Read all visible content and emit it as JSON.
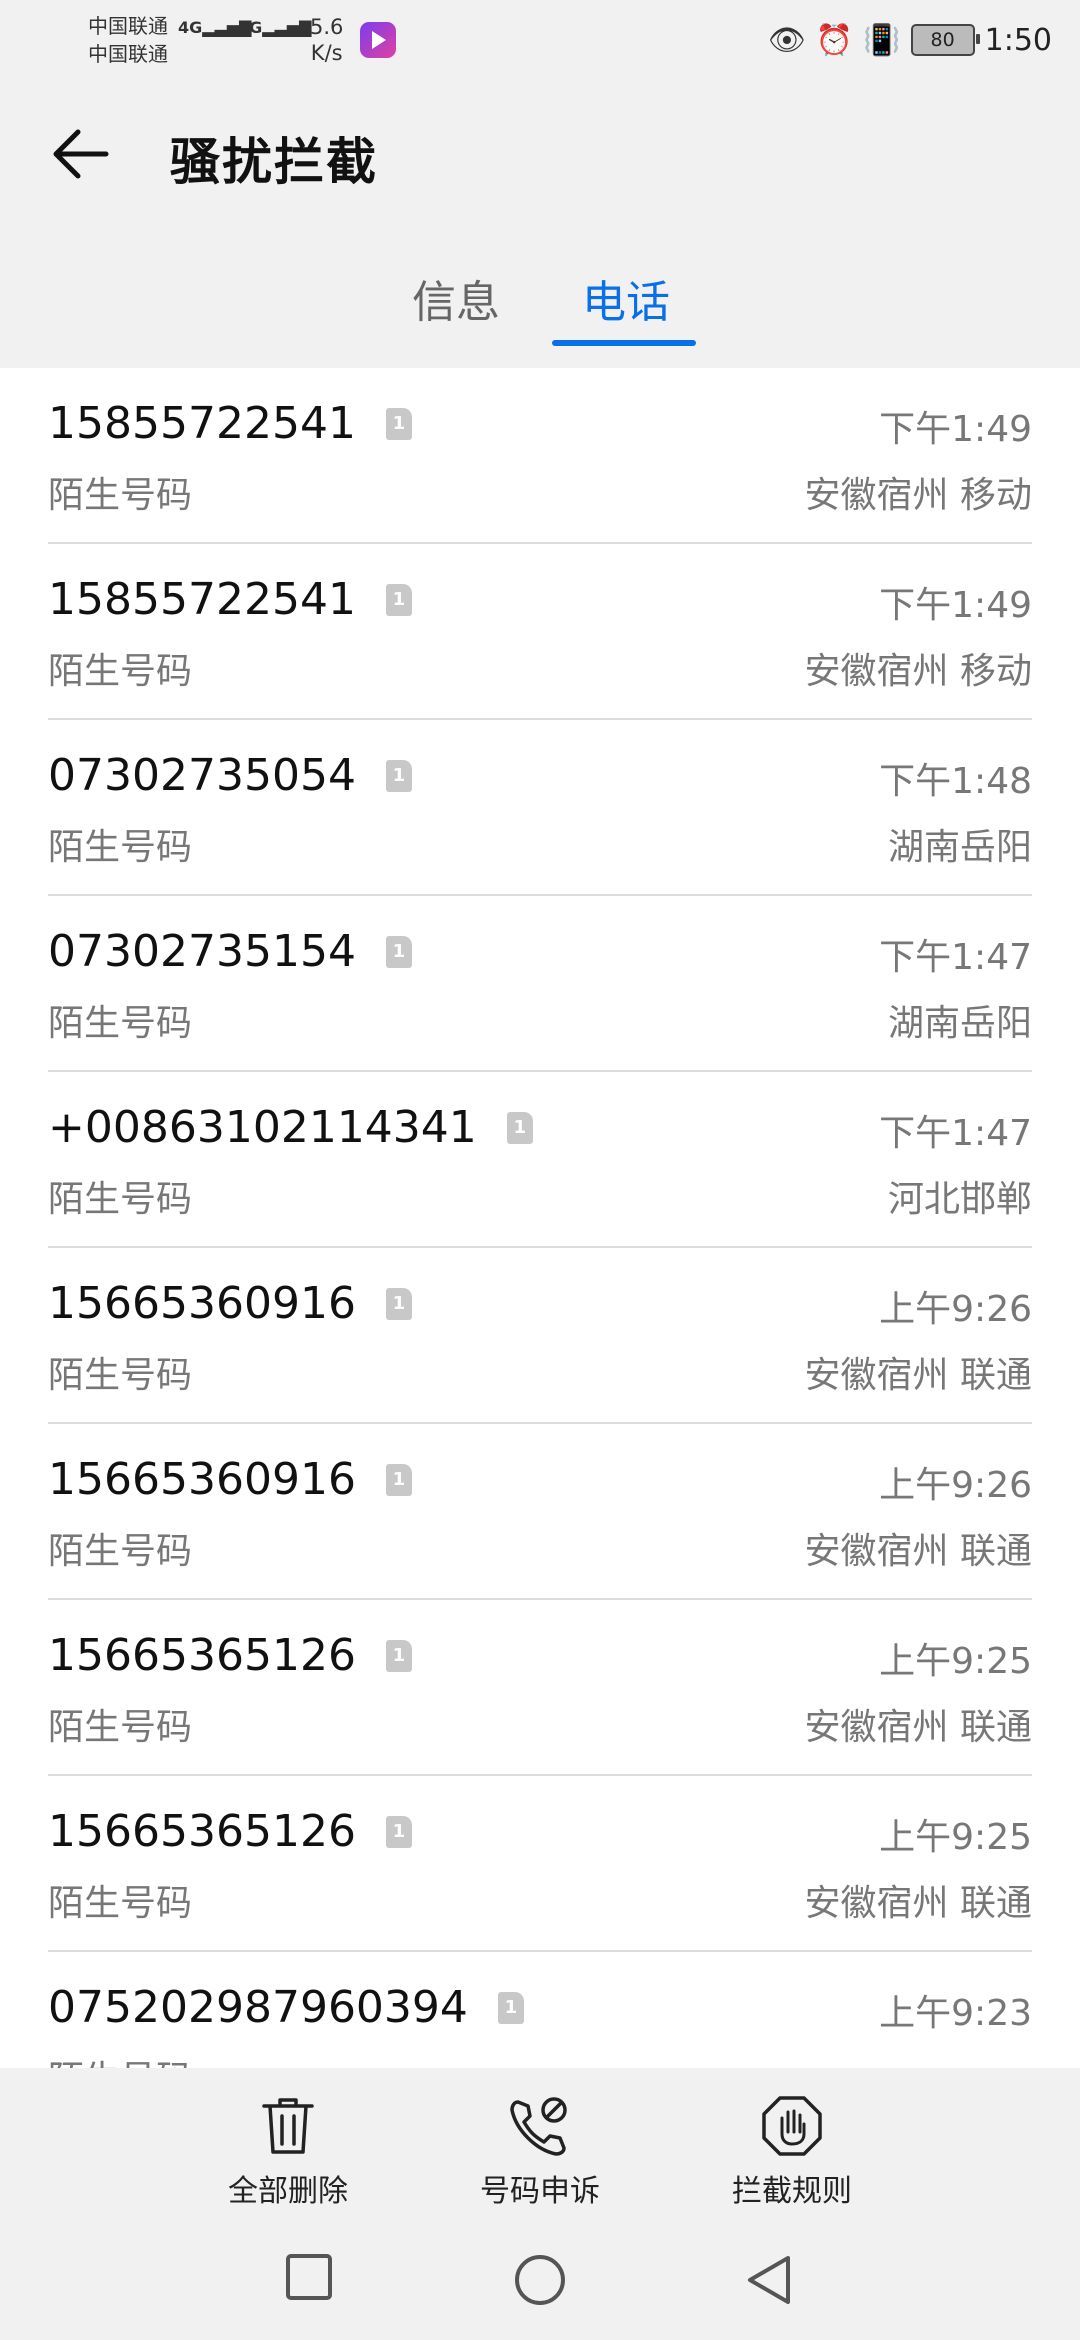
{
  "status_bar": {
    "carrier1": "中国联通",
    "carrier2": "中国联通",
    "net1": "4G",
    "net2": "4G",
    "speed_value": "5.6",
    "speed_unit": "K/s",
    "battery": "80",
    "time": "1:50"
  },
  "header": {
    "title": "骚扰拦截"
  },
  "tabs": [
    {
      "label": "信息",
      "active": false
    },
    {
      "label": "电话",
      "active": true
    }
  ],
  "calls": [
    {
      "number": "15855722541",
      "sim": "1",
      "label": "陌生号码",
      "time": "下午1:49",
      "location": "安徽宿州 移动"
    },
    {
      "number": "15855722541",
      "sim": "1",
      "label": "陌生号码",
      "time": "下午1:49",
      "location": "安徽宿州 移动"
    },
    {
      "number": "07302735054",
      "sim": "1",
      "label": "陌生号码",
      "time": "下午1:48",
      "location": "湖南岳阳"
    },
    {
      "number": "07302735154",
      "sim": "1",
      "label": "陌生号码",
      "time": "下午1:47",
      "location": "湖南岳阳"
    },
    {
      "number": "+00863102114341",
      "sim": "1",
      "label": "陌生号码",
      "time": "下午1:47",
      "location": "河北邯郸"
    },
    {
      "number": "15665360916",
      "sim": "1",
      "label": "陌生号码",
      "time": "上午9:26",
      "location": "安徽宿州 联通"
    },
    {
      "number": "15665360916",
      "sim": "1",
      "label": "陌生号码",
      "time": "上午9:26",
      "location": "安徽宿州 联通"
    },
    {
      "number": "15665365126",
      "sim": "1",
      "label": "陌生号码",
      "time": "上午9:25",
      "location": "安徽宿州 联通"
    },
    {
      "number": "15665365126",
      "sim": "1",
      "label": "陌生号码",
      "time": "上午9:25",
      "location": "安徽宿州 联通"
    },
    {
      "number": "075202987960394",
      "sim": "1",
      "label": "陌生号码",
      "time": "上午9:23",
      "location": ""
    }
  ],
  "toolbar": {
    "delete_all": "全部删除",
    "appeal": "号码申诉",
    "rules": "拦截规则"
  },
  "colors": {
    "accent": "#0a70e8"
  }
}
